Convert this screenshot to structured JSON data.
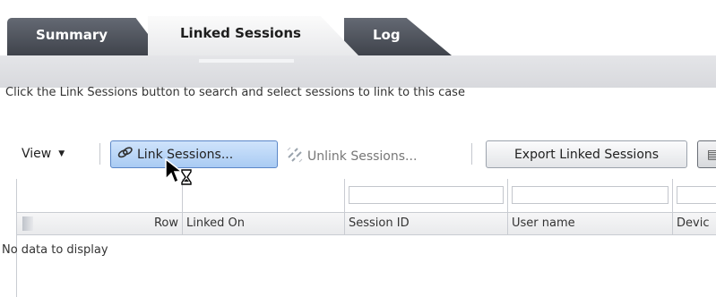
{
  "tabs": [
    {
      "label": "Summary",
      "selected": false
    },
    {
      "label": "Linked Sessions",
      "selected": true
    },
    {
      "label": "Log",
      "selected": false
    }
  ],
  "instructions": "Click the Link Sessions button to search and select sessions to link to this case",
  "toolbar": {
    "view_label": "View",
    "link_label": "Link Sessions...",
    "unlink_label": "Unlink Sessions...",
    "export_label": "Export Linked Sessions"
  },
  "table": {
    "columns": [
      "Row",
      "Linked On",
      "Session ID",
      "User name",
      "Devic"
    ],
    "empty_message": "No data to display"
  },
  "icons": {
    "link": "link-icon",
    "unlink": "unlink-icon",
    "view_caret": "chevron-down-icon",
    "more": "columns-icon",
    "cursor": "busy-cursor-icon"
  },
  "colors": {
    "tab_dark": "#4f545c",
    "tab_active": "#f4f4f5",
    "link_button": "#b9d5f6",
    "link_button_border": "#5b87c8"
  }
}
